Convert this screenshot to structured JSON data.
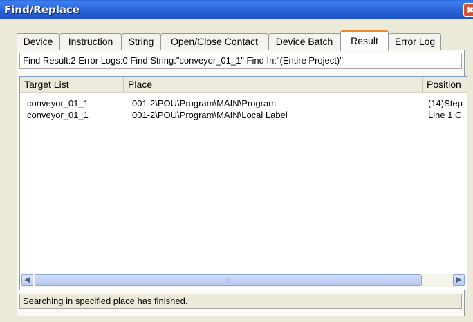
{
  "window": {
    "title": "Find/Replace",
    "close_glyph": "✖"
  },
  "tabs": [
    {
      "label": "Device",
      "active": false
    },
    {
      "label": "Instruction",
      "active": false
    },
    {
      "label": "String",
      "active": false
    },
    {
      "label": "Open/Close Contact",
      "active": false
    },
    {
      "label": "Device Batch",
      "active": false
    },
    {
      "label": "Result",
      "active": true
    },
    {
      "label": "Error Log",
      "active": false
    }
  ],
  "summary": {
    "text": "Find Result:2  Error Logs:0  Find String:\"conveyor_01_1\"  Find In:\"(Entire Project)\""
  },
  "results": {
    "columns": [
      "Target List",
      "Place",
      "Position"
    ],
    "rows": [
      [
        "conveyor_01_1",
        "001-2\\POU\\Program\\MAIN\\Program",
        "(14)Step"
      ],
      [
        "conveyor_01_1",
        "001-2\\POU\\Program\\MAIN\\Local Label",
        "Line 1 C"
      ]
    ]
  },
  "scrollbar": {
    "left_arrow": "◀",
    "right_arrow": "▶",
    "grip": "|||"
  },
  "status": {
    "text": "Searching in specified place has finished."
  }
}
